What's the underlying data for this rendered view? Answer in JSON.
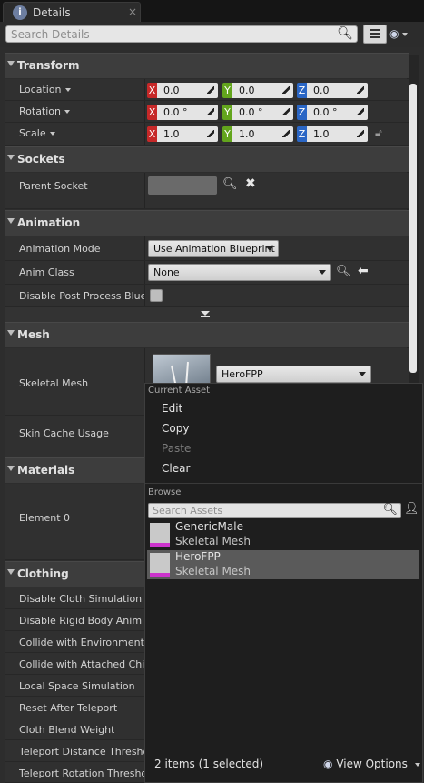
{
  "tab": {
    "title": "Details",
    "close": "×"
  },
  "search": {
    "placeholder": "Search Details"
  },
  "sections": {
    "transform": "Transform",
    "sockets": "Sockets",
    "animation": "Animation",
    "mesh": "Mesh",
    "materials": "Materials",
    "clothing": "Clothing"
  },
  "transform": {
    "location": {
      "label": "Location",
      "x": "0.0",
      "y": "0.0",
      "z": "0.0"
    },
    "rotation": {
      "label": "Rotation",
      "x": "0.0 °",
      "y": "0.0 °",
      "z": "0.0 °"
    },
    "scale": {
      "label": "Scale",
      "x": "1.0",
      "y": "1.0",
      "z": "1.0"
    },
    "axes": {
      "x": "X",
      "y": "Y",
      "z": "Z"
    }
  },
  "sockets": {
    "parent_socket": "Parent Socket"
  },
  "animation": {
    "mode_label": "Animation Mode",
    "mode_value": "Use Animation Blueprint",
    "class_label": "Anim Class",
    "class_value": "None",
    "disable_pp_label": "Disable Post Process Bluep"
  },
  "mesh": {
    "skeletal_label": "Skeletal Mesh",
    "skeletal_value": "HeroFPP",
    "skin_cache_label": "Skin Cache Usage"
  },
  "materials": {
    "element0": "Element 0"
  },
  "clothing": [
    "Disable Cloth Simulation",
    "Disable Rigid Body Anim No",
    "Collide with Environment",
    "Collide with Attached Childr",
    "Local Space Simulation",
    "Reset After Teleport",
    "Cloth Blend Weight",
    "Teleport Distance Threshol",
    "Teleport Rotation Threshold"
  ],
  "popup": {
    "current_asset": "Current Asset",
    "edit": "Edit",
    "copy": "Copy",
    "paste": "Paste",
    "clear": "Clear",
    "browse": "Browse",
    "search_placeholder": "Search Assets",
    "assets": [
      {
        "name": "GenericMale",
        "type": "Skeletal Mesh",
        "selected": false
      },
      {
        "name": "HeroFPP",
        "type": "Skeletal Mesh",
        "selected": true
      }
    ],
    "footer": "2 items (1 selected)",
    "view_options": "View Options"
  },
  "colors": {
    "axis_x": "#c62828",
    "axis_y": "#63a51d",
    "axis_z": "#2a66c5",
    "asset_accent": "#cc33cc"
  }
}
